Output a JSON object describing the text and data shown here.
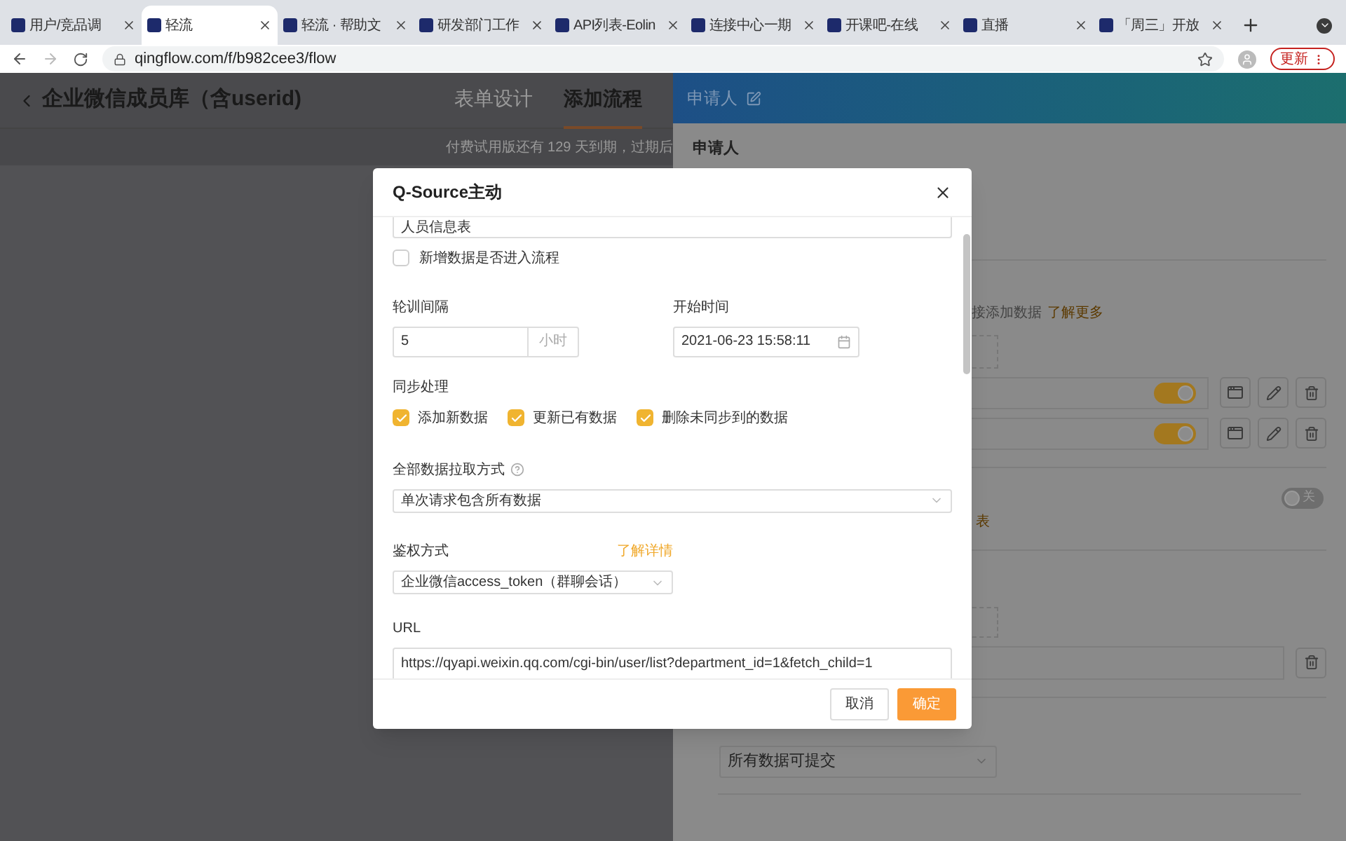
{
  "browser": {
    "tabs": [
      {
        "title": "用户/竞品调",
        "selected": false
      },
      {
        "title": "轻流",
        "selected": true
      },
      {
        "title": "轻流 · 帮助文",
        "selected": false
      },
      {
        "title": "研发部门工作",
        "selected": false
      },
      {
        "title": "API列表-Eolin",
        "selected": false
      },
      {
        "title": "连接中心一期",
        "selected": false
      },
      {
        "title": "开课吧-在线",
        "selected": false
      },
      {
        "title": "直播",
        "selected": false
      },
      {
        "title": "「周三」开放",
        "selected": false
      }
    ],
    "address": "qingflow.com/f/b982cee3/flow",
    "update_button": "更新"
  },
  "page": {
    "title": "企业微信成员库（含userid)",
    "tabs": [
      {
        "label": "表单设计",
        "selected": false
      },
      {
        "label": "添加流程",
        "selected": true
      }
    ],
    "notice": "付费试用版还有 129 天到期，过期后"
  },
  "side_panel": {
    "title": "申请人",
    "section_label": "申请人",
    "hint": "接添加数据",
    "hint_link": "了解更多",
    "rows": [
      {
        "on": true
      },
      {
        "on": true
      }
    ],
    "switch": {
      "label": "关",
      "on": false
    },
    "link_fragment": "表",
    "select": "所有数据可提交"
  },
  "dialog": {
    "title": "Q-Source主动",
    "table_value": "人员信息表",
    "enter_flow": {
      "label": "新增数据是否进入流程",
      "checked": false
    },
    "interval": {
      "label": "轮训间隔",
      "value": "5",
      "unit": "小时"
    },
    "start_time": {
      "label": "开始时间",
      "value": "2021-06-23 15:58:11"
    },
    "sync": {
      "label": "同步处理",
      "options": [
        {
          "label": "添加新数据",
          "checked": true
        },
        {
          "label": "更新已有数据",
          "checked": true
        },
        {
          "label": "删除未同步到的数据",
          "checked": true
        }
      ]
    },
    "fetch_mode": {
      "label": "全部数据拉取方式",
      "value": "单次请求包含所有数据"
    },
    "auth": {
      "label": "鉴权方式",
      "link": "了解详情",
      "value": "企业微信access_token（群聊会话）"
    },
    "url": {
      "label": "URL",
      "value": "https://qyapi.weixin.qq.com/cgi-bin/user/list?department_id=1&fetch_child=1"
    },
    "buttons": {
      "cancel": "取消",
      "ok": "确定"
    }
  }
}
